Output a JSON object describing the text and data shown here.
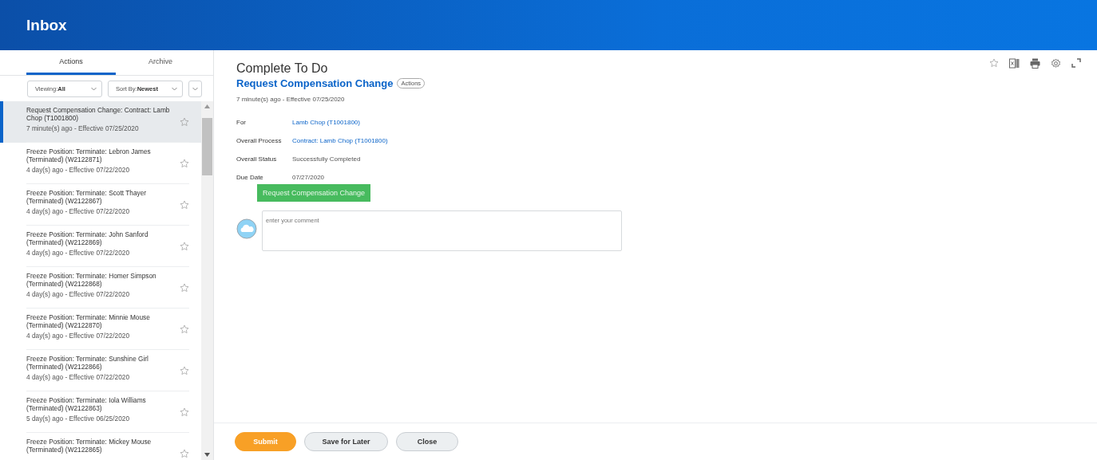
{
  "header": {
    "title": "Inbox"
  },
  "tabs": [
    {
      "label": "Actions",
      "selected": true
    },
    {
      "label": "Archive",
      "selected": false
    }
  ],
  "filters": [
    {
      "label": "Viewing:",
      "value": "All"
    },
    {
      "label": "Sort By:",
      "value": "Newest"
    }
  ],
  "inbox_items": [
    {
      "title": "Request Compensation Change: Contract: Lamb Chop (T1001800)",
      "meta": "7 minute(s) ago - Effective 07/25/2020",
      "selected": true
    },
    {
      "title": "Freeze Position: Terminate: Lebron James (Terminated) (W2122871)",
      "meta": "4 day(s) ago - Effective 07/22/2020",
      "selected": false
    },
    {
      "title": "Freeze Position: Terminate: Scott Thayer (Terminated) (W2122867)",
      "meta": "4 day(s) ago - Effective 07/22/2020",
      "selected": false
    },
    {
      "title": "Freeze Position: Terminate: John Sanford (Terminated) (W2122869)",
      "meta": "4 day(s) ago - Effective 07/22/2020",
      "selected": false
    },
    {
      "title": "Freeze Position: Terminate: Homer Simpson (Terminated) (W2122868)",
      "meta": "4 day(s) ago - Effective 07/22/2020",
      "selected": false
    },
    {
      "title": "Freeze Position: Terminate: Minnie Mouse (Terminated) (W2122870)",
      "meta": "4 day(s) ago - Effective 07/22/2020",
      "selected": false
    },
    {
      "title": "Freeze Position: Terminate: Sunshine Girl (Terminated) (W2122866)",
      "meta": "4 day(s) ago - Effective 07/22/2020",
      "selected": false
    },
    {
      "title": "Freeze Position: Terminate: Iola Williams (Terminated) (W2122863)",
      "meta": "5 day(s) ago - Effective 06/25/2020",
      "selected": false
    },
    {
      "title": "Freeze Position: Terminate: Mickey Mouse (Terminated) (W2122865)",
      "selected": false
    }
  ],
  "detail": {
    "heading": "Complete To Do",
    "task": "Request Compensation Change",
    "actions_badge": "Actions",
    "meta": "7 minute(s) ago -  Effective 07/25/2020",
    "fields": [
      {
        "label": "For",
        "value": "Lamb Chop (T1001800)",
        "kind": "link"
      },
      {
        "label": "Overall Process",
        "value": "Contract: Lamb Chop (T1001800)",
        "kind": "link"
      },
      {
        "label": "Overall Status",
        "value": "Successfully Completed",
        "kind": "text"
      },
      {
        "label": "Due Date",
        "value": "07/27/2020",
        "kind": "text"
      }
    ],
    "step_button": "Request Compensation Change",
    "comment": {
      "placeholder": "enter your comment"
    }
  },
  "footer_buttons": [
    {
      "label": "Submit",
      "kind": "primary"
    },
    {
      "label": "Save for Later",
      "kind": "secondary"
    },
    {
      "label": "Close",
      "kind": "secondary"
    }
  ]
}
